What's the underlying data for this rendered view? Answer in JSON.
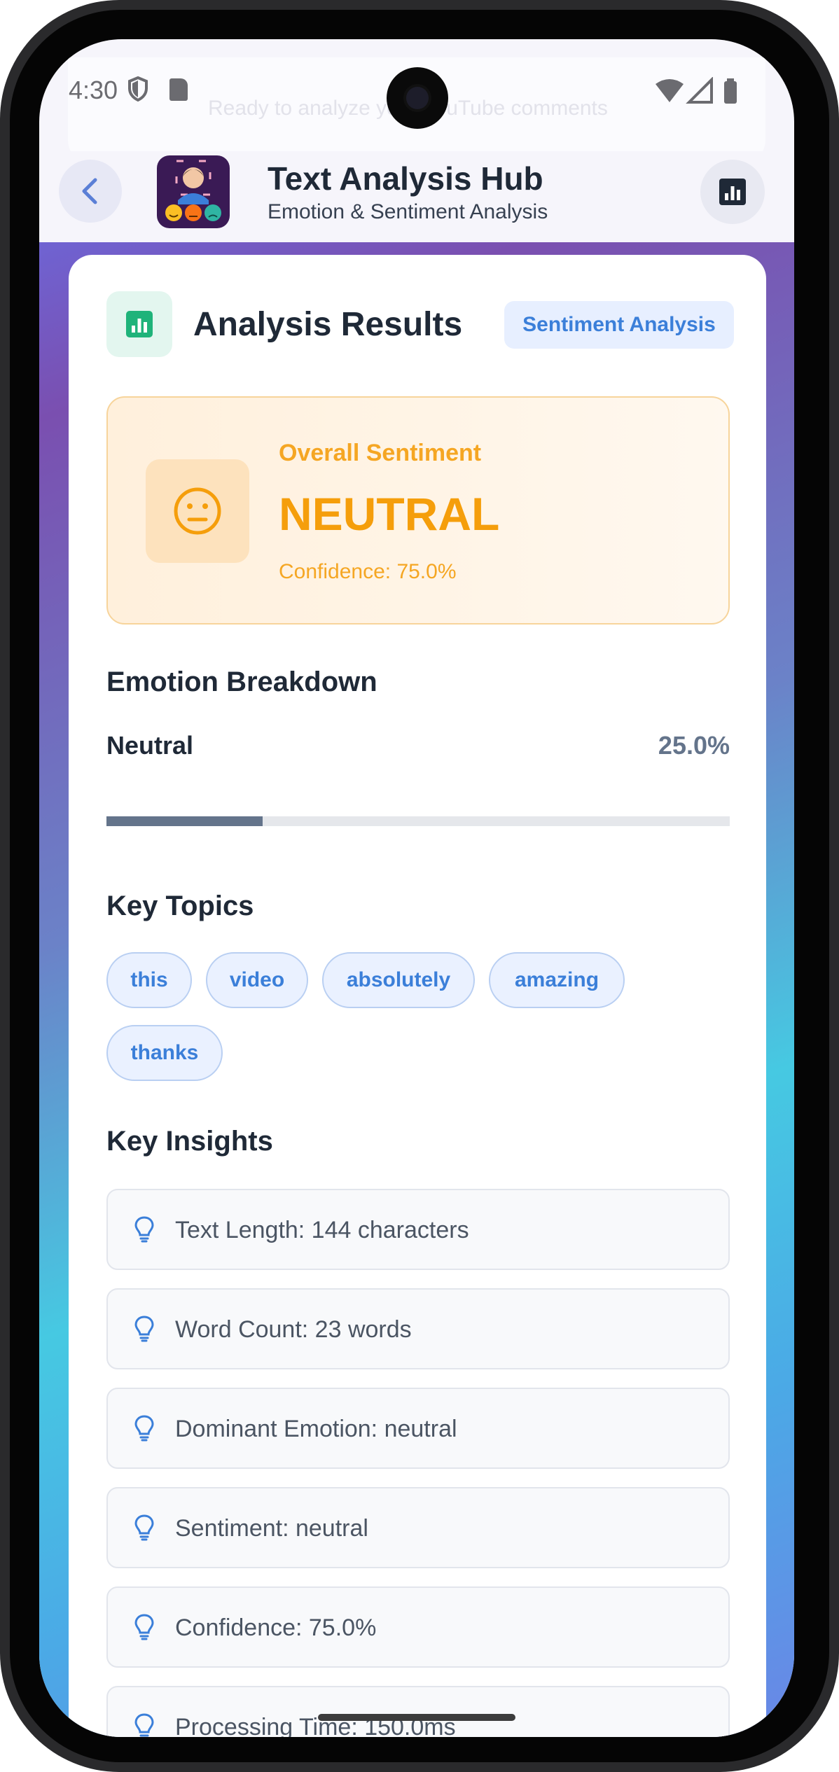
{
  "status_bar": {
    "time": "4:30",
    "ghost_text": "Ready to analyze your YouTube comments"
  },
  "app_bar": {
    "title": "Text Analysis Hub",
    "subtitle": "Emotion & Sentiment Analysis"
  },
  "results": {
    "title": "Analysis Results",
    "tag": "Sentiment Analysis",
    "overall_label": "Overall Sentiment",
    "overall_value": "NEUTRAL",
    "confidence_text": "Confidence: 75.0%"
  },
  "emotion": {
    "heading": "Emotion Breakdown",
    "items": [
      {
        "label": "Neutral",
        "value_text": "25.0%",
        "fraction": 0.25
      }
    ]
  },
  "topics": {
    "heading": "Key Topics",
    "chips": [
      "this",
      "video",
      "absolutely",
      "amazing",
      "thanks"
    ]
  },
  "insights": {
    "heading": "Key Insights",
    "items": [
      "Text Length: 144 characters",
      "Word Count: 23 words",
      "Dominant Emotion: neutral",
      "Sentiment: neutral",
      "Confidence: 75.0%",
      "Processing Time: 150.0ms"
    ]
  },
  "colors": {
    "accent": "#3b7fd9",
    "neutral_orange": "#f59e0b",
    "bar": "#64748b"
  }
}
